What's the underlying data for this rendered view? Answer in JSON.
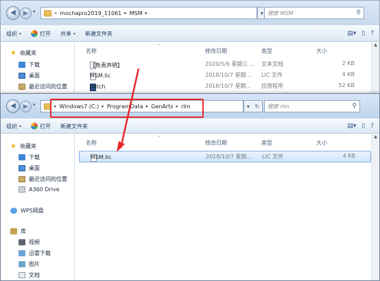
{
  "back_window": {
    "address": {
      "crumbs": [
        "mochapro2019_11061",
        "MSM"
      ],
      "prefix": "«"
    },
    "search_placeholder": "搜索 MSM",
    "toolbar": {
      "organize": "组织",
      "open": "打开",
      "share": "共享",
      "new_folder": "新建文件夹"
    },
    "nav": [
      {
        "label": "收藏夹",
        "icon": "star-icon"
      },
      {
        "label": "下载",
        "icon": "download-folder-icon"
      },
      {
        "label": "桌面",
        "icon": "desktop-icon"
      },
      {
        "label": "最近访问的位置",
        "icon": "recent-places-icon"
      }
    ],
    "columns": {
      "name": "名称",
      "date": "修改日期",
      "type": "类型",
      "size": "大小"
    },
    "files": [
      {
        "name": "【免责声明】",
        "date": "2020/5/6 星期三 ...",
        "type": "文本文档",
        "size": "2 KB",
        "icon": "text-file-icon"
      },
      {
        "name": "MSM.lic",
        "date": "2018/10/7 星期...",
        "type": "LIC 文件",
        "size": "4 KB",
        "icon": "file-icon"
      },
      {
        "name": "patch",
        "date": "2018/10/7 星期...",
        "type": "应用程序",
        "size": "52 KB",
        "icon": "application-icon"
      }
    ]
  },
  "front_window": {
    "address": {
      "crumbs": [
        "Windows7 (C:)",
        "ProgramData",
        "GenArts",
        "rlm"
      ]
    },
    "search_placeholder": "搜索 rlm",
    "toolbar": {
      "organize": "组织",
      "open": "打开",
      "new_folder": "新建文件夹"
    },
    "nav": [
      {
        "label": "收藏夹",
        "icon": "star-icon"
      },
      {
        "label": "下载",
        "icon": "download-folder-icon"
      },
      {
        "label": "桌面",
        "icon": "desktop-icon"
      },
      {
        "label": "最近访问的位置",
        "icon": "recent-places-icon"
      },
      {
        "label": "A360 Drive",
        "icon": "a360-drive-icon"
      },
      {
        "label": "WPS网盘",
        "icon": "wps-cloud-icon"
      },
      {
        "label": "库",
        "icon": "library-icon"
      },
      {
        "label": "视频",
        "icon": "video-library-icon"
      },
      {
        "label": "迅雷下载",
        "icon": "thunder-download-icon"
      },
      {
        "label": "图片",
        "icon": "pictures-library-icon"
      },
      {
        "label": "文档",
        "icon": "documents-library-icon"
      }
    ],
    "columns": {
      "name": "名称",
      "date": "修改日期",
      "type": "类型",
      "size": "大小"
    },
    "files": [
      {
        "name": "MSM.lic",
        "date": "2018/10/7 星期...",
        "type": "LIC 文件",
        "size": "4 KB",
        "icon": "file-icon",
        "selected": true
      }
    ]
  },
  "annotation": {
    "highlight_color": "#e8262a"
  }
}
